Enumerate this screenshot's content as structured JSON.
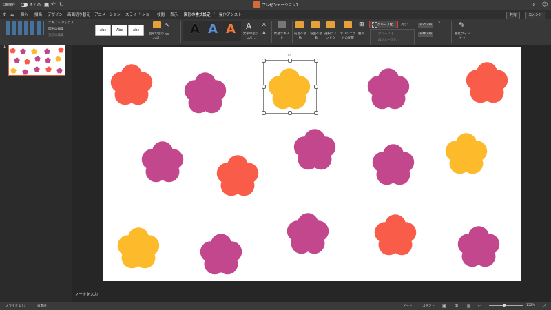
{
  "titlebar": {
    "autosave_label": "自動保存",
    "autosave_state": "オフ",
    "document_title": "プレゼンテーション1",
    "more": "…"
  },
  "tabs": [
    "ホーム",
    "挿入",
    "描画",
    "デザイン",
    "画面切り替え",
    "アニメーション",
    "スライド ショー",
    "校閲",
    "表示",
    "図形の書式設定"
  ],
  "active_tab": "図形の書式設定",
  "assist": "操作アシスト",
  "share_label": "共有",
  "comment_label": "コメント",
  "ribbon": {
    "textbox": "テキスト ボックス",
    "edit_shape": "図形の編集",
    "edit_points": "頂点の編集",
    "style_samples": [
      "Abc",
      "Abc",
      "Abc"
    ],
    "fill_label": "図形の塗りつぶし",
    "wordart_letters": [
      "A",
      "A",
      "A"
    ],
    "text_fill_label": "文字の塗りつぶし",
    "alt_text_label": "代替テキスト",
    "forward_label": "前面へ移動",
    "backward_label": "背面へ移動",
    "select_label": "選択ウィンドウ",
    "align_label": "オブジェクトの配置",
    "arrange_label": "整列",
    "group_button": "グループ化",
    "group_menu": [
      "グループ化",
      "再グループ化",
      "グループ解除"
    ],
    "height_label": "高さ:",
    "height_value": "3.35 cm",
    "width_value": "3.46 cm",
    "format_pane_label": "書式ウィンドウ"
  },
  "slide_number": "1",
  "notes_placeholder": "ノートを入力",
  "status": {
    "slide_info": "スライド 1 / 1",
    "language": "日本語",
    "notes": "ノート",
    "comments": "コメント",
    "zoom": "152%"
  },
  "colors": {
    "red": "#f95d4a",
    "magenta": "#c2478d",
    "yellow": "#fdbb2c",
    "accent": "#e03a2f"
  },
  "slide_flowers": [
    {
      "color": "red"
    },
    {
      "color": "magenta"
    },
    {
      "color": "yellow",
      "selected": true
    },
    {
      "color": "magenta"
    },
    {
      "color": "red"
    },
    {
      "color": "magenta"
    },
    {
      "color": "red"
    },
    {
      "color": "magenta"
    },
    {
      "color": "magenta"
    },
    {
      "color": "yellow"
    },
    {
      "color": "yellow"
    },
    {
      "color": "magenta"
    },
    {
      "color": "magenta"
    },
    {
      "color": "red"
    },
    {
      "color": "magenta"
    }
  ]
}
